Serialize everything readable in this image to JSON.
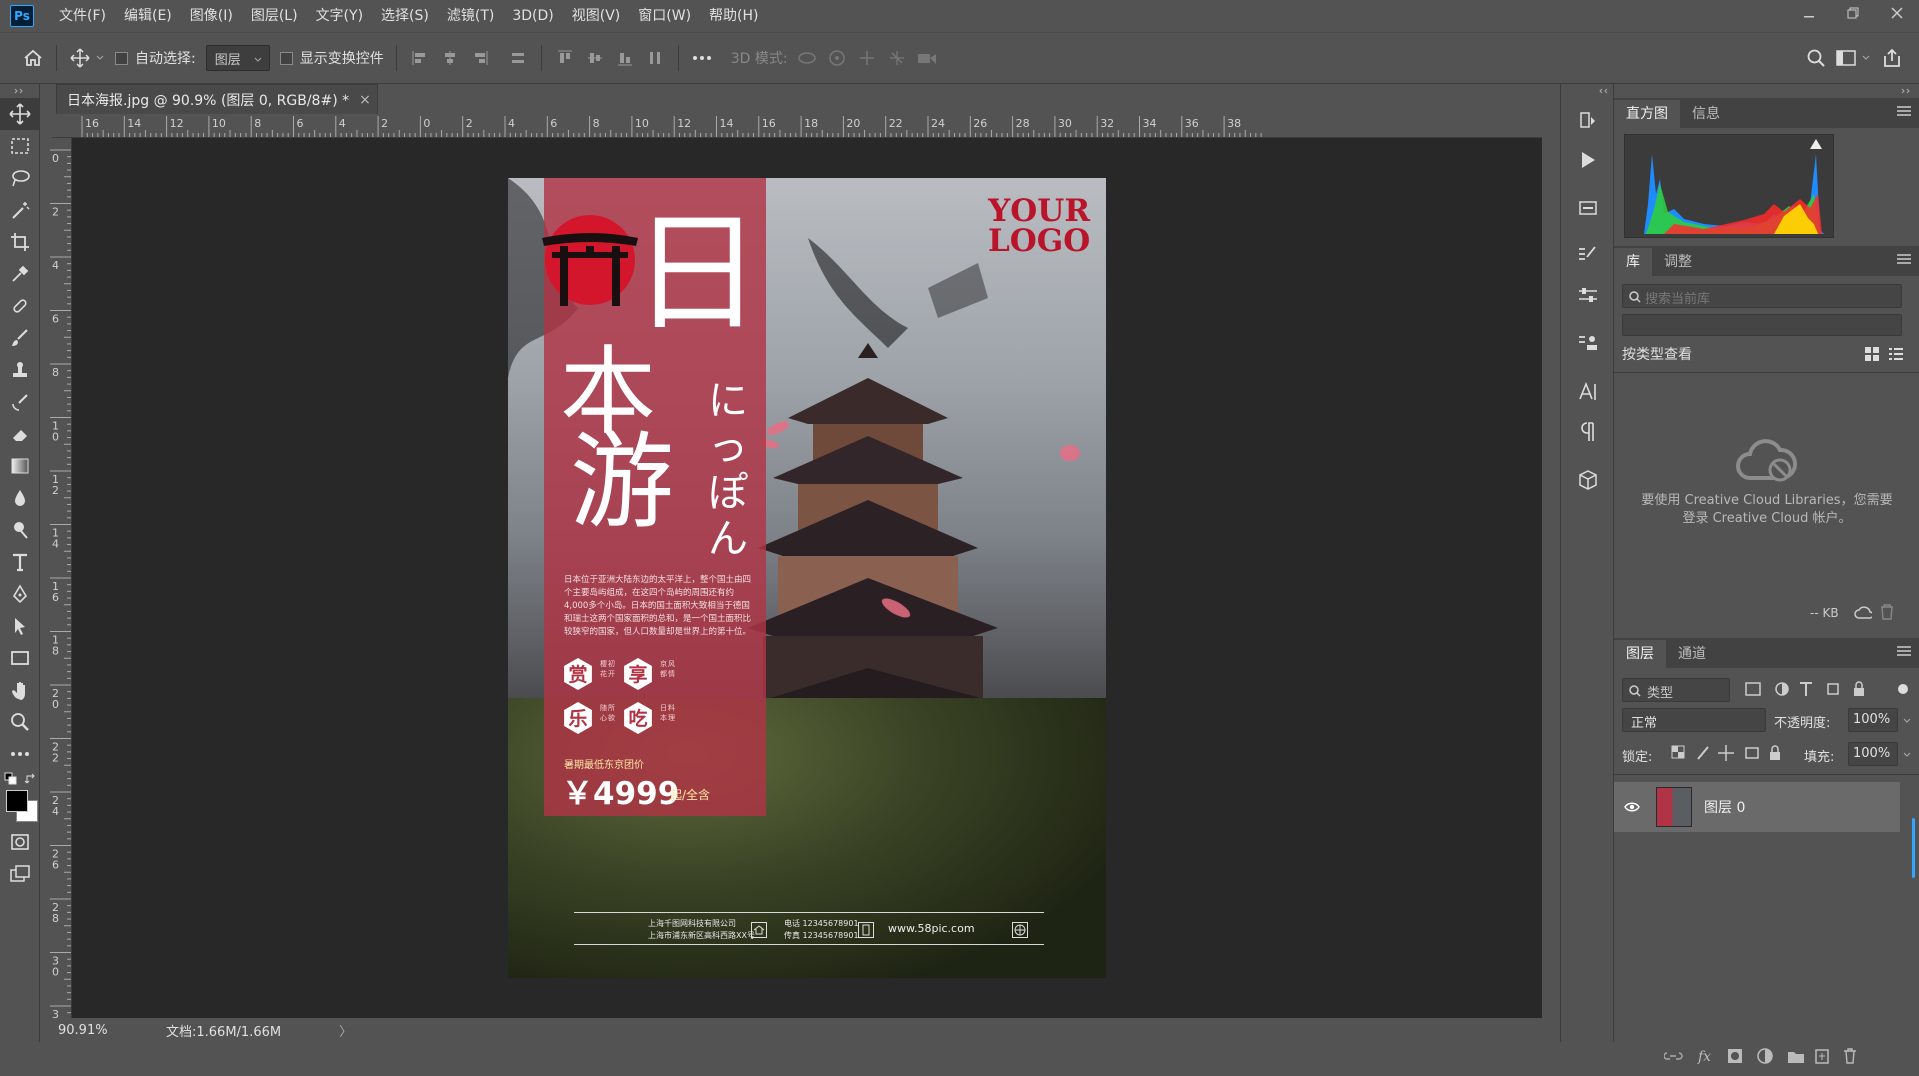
{
  "app": {
    "logo": "Ps"
  },
  "menu": [
    "文件(F)",
    "编辑(E)",
    "图像(I)",
    "图层(L)",
    "文字(Y)",
    "选择(S)",
    "滤镜(T)",
    "3D(D)",
    "视图(V)",
    "窗口(W)",
    "帮助(H)"
  ],
  "options": {
    "auto_select_label": "自动选择:",
    "auto_select_value": "图层",
    "show_transform_label": "显示变换控件",
    "mode_3d_label": "3D 模式:"
  },
  "document": {
    "tab_title": "日本海报.jpg @ 90.9% (图层 0, RGB/8#) *",
    "close": "×",
    "ruler_h_labels": [
      "16",
      "14",
      "12",
      "10",
      "8",
      "6",
      "4",
      "2",
      "0",
      "2",
      "4",
      "6",
      "8",
      "10",
      "12",
      "14",
      "16",
      "18",
      "20",
      "22",
      "24",
      "26",
      "28",
      "30",
      "32",
      "34",
      "36",
      "38"
    ],
    "ruler_v_labels": [
      "0",
      "2",
      "4",
      "6",
      "8",
      "1\n0",
      "1\n2",
      "1\n4",
      "1\n6",
      "1\n8",
      "2\n0",
      "2\n2",
      "2\n4",
      "2\n6",
      "2\n8",
      "3\n0",
      "3"
    ]
  },
  "poster": {
    "logo_line1": "YOUR",
    "logo_line2": "LOGO",
    "title_1": "日",
    "title_2": "本",
    "title_3": "游",
    "kana": "にっぽん",
    "intro": "日本位于亚洲大陆东边的太平洋上，整个国土由四个主要岛屿组成，在这四个岛屿的周围还有约4,000多个小岛。日本的国土面积大致相当于德国和瑞士这两个国家面积的总和，是一个国土面积比较狭窄的国家，但人口数量却是世界上的第十位。",
    "badges": [
      "赏",
      "享",
      "乐",
      "吃"
    ],
    "badge_notes": [
      "樱花初开",
      "京都风情",
      "随心所欲",
      "日本料理"
    ],
    "price_caption": "暑期最低东京团价",
    "price": "￥4999",
    "price_suffix": "起/全含",
    "footer_company": "上海千图网科技有限公司",
    "footer_address": "上海市浦东新区高科西路XX号",
    "footer_phone1": "电话 12345678901",
    "footer_phone2": "传真 12345678901",
    "footer_web": "www.58pic.com"
  },
  "status": {
    "zoom": "90.91%",
    "doc_size": "文档:1.66M/1.66M",
    "arrow": "〉"
  },
  "panels": {
    "histogram_tabs": [
      "直方图",
      "信息"
    ],
    "library_tabs": [
      "库",
      "调整"
    ],
    "library_search_placeholder": "搜索当前库",
    "library_view_label": "按类型查看",
    "library_message": "要使用 Creative Cloud Libraries，您需要登录 Creative Cloud 帐户。",
    "library_kb": "-- KB",
    "layers_tabs": [
      "图层",
      "通道"
    ],
    "layers_filter": "类型",
    "blend_mode": "正常",
    "opacity_label": "不透明度:",
    "opacity_value": "100%",
    "lock_label": "锁定:",
    "fill_label": "填充:",
    "fill_value": "100%",
    "layer_name": "图层 0"
  },
  "colors": {
    "accent": "#31a8ff",
    "poster_red": "#b03446",
    "canvas_bg": "#282828",
    "ui_bg": "#535353"
  }
}
